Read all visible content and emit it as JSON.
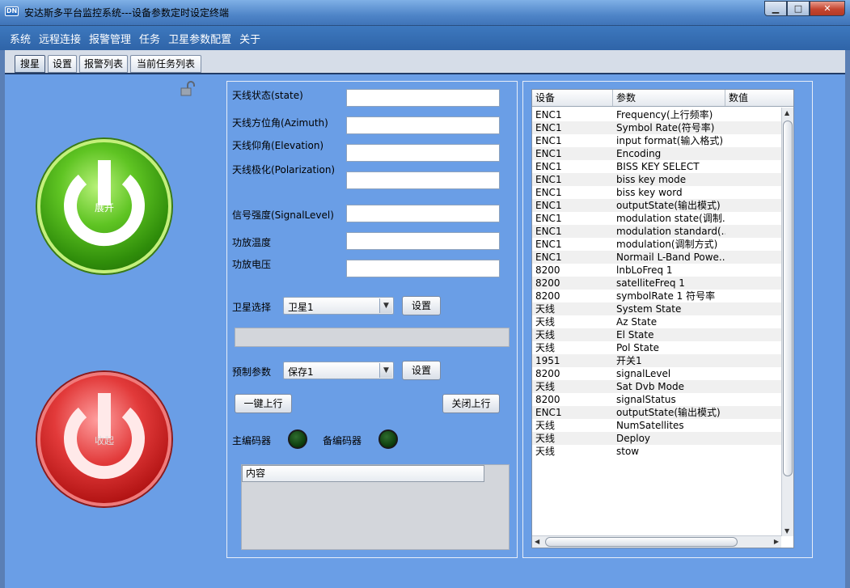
{
  "window": {
    "title": "安达斯多平台监控系统---设备参数定时设定终端",
    "app_icon_text": "DN",
    "controls": {
      "minimize": "▁",
      "maximize": "□",
      "close": "✕"
    }
  },
  "menu": [
    "系统",
    "远程连接",
    "报警管理",
    "任务",
    "卫星参数配置",
    "关于"
  ],
  "tabs": [
    {
      "label": "搜星",
      "active": true
    },
    {
      "label": "设置",
      "active": false
    },
    {
      "label": "报警列表",
      "active": false
    },
    {
      "label": "当前任务列表",
      "active": false
    }
  ],
  "power": {
    "expand_label": "展开",
    "collapse_label": "收起"
  },
  "fields": [
    {
      "label": "天线状态(state)",
      "value": ""
    },
    {
      "label": "天线方位角(Azimuth)",
      "value": ""
    },
    {
      "label": "天线仰角(Elevation)",
      "value": ""
    },
    {
      "label": "天线极化(Polarization)",
      "value": ""
    },
    {
      "label": "信号强度(SignalLevel)",
      "value": ""
    },
    {
      "label": "功放温度",
      "value": ""
    },
    {
      "label": "功放电压",
      "value": ""
    }
  ],
  "satellite": {
    "label": "卫星选择",
    "selected": "卫星1",
    "button": "设置"
  },
  "preset": {
    "label": "预制参数",
    "selected": "保存1",
    "button": "设置"
  },
  "actions": {
    "uplink_on": "一键上行",
    "uplink_off": "关闭上行"
  },
  "encoders": {
    "main": "主编码器",
    "backup": "备编码器"
  },
  "content_header": "内容",
  "table": {
    "columns": [
      "设备",
      "参数",
      "数值"
    ],
    "rows": [
      [
        "ENC1",
        "Frequency(上行频率)",
        ""
      ],
      [
        "ENC1",
        "Symbol Rate(符号率)",
        ""
      ],
      [
        "ENC1",
        "input format(输入格式)",
        ""
      ],
      [
        "ENC1",
        "Encoding",
        ""
      ],
      [
        "ENC1",
        "BISS KEY SELECT",
        ""
      ],
      [
        "ENC1",
        "biss key mode",
        ""
      ],
      [
        "ENC1",
        "biss key word",
        ""
      ],
      [
        "ENC1",
        "outputState(输出模式)",
        ""
      ],
      [
        "ENC1",
        "modulation state(调制...",
        ""
      ],
      [
        "ENC1",
        "modulation standard(...",
        ""
      ],
      [
        "ENC1",
        "modulation(调制方式)",
        ""
      ],
      [
        "ENC1",
        "Normail L-Band Powe...",
        ""
      ],
      [
        "8200",
        "lnbLoFreq 1",
        ""
      ],
      [
        "8200",
        "satelliteFreq 1",
        ""
      ],
      [
        "8200",
        "symbolRate 1 符号率",
        ""
      ],
      [
        "天线",
        "System State",
        ""
      ],
      [
        "天线",
        "Az State",
        ""
      ],
      [
        "天线",
        "El State",
        ""
      ],
      [
        "天线",
        "Pol State",
        ""
      ],
      [
        "1951",
        "开关1",
        ""
      ],
      [
        "8200",
        "signalLevel",
        ""
      ],
      [
        "天线",
        "Sat Dvb Mode",
        ""
      ],
      [
        "8200",
        "signalStatus",
        ""
      ],
      [
        "ENC1",
        "outputState(输出模式)",
        ""
      ],
      [
        "天线",
        "NumSatellites",
        ""
      ],
      [
        "天线",
        "Deploy",
        ""
      ],
      [
        "天线",
        "stow",
        ""
      ]
    ]
  }
}
